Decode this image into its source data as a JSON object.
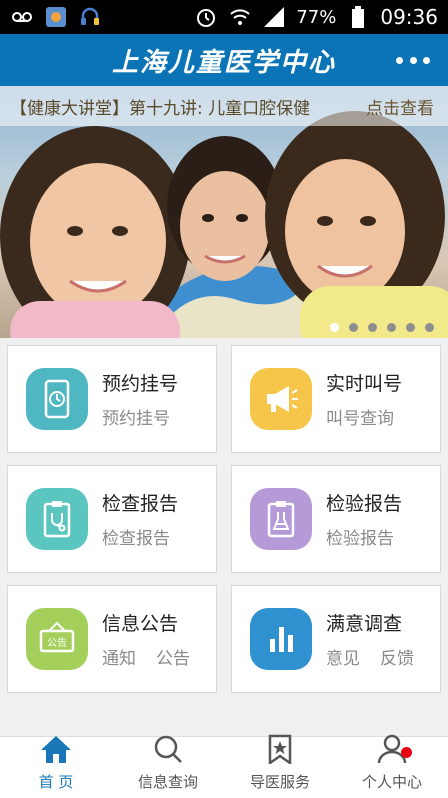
{
  "status_bar": {
    "battery": "77%",
    "time": "09:36",
    "icons": [
      "voicemail-icon",
      "app-notification-icon",
      "headset-icon",
      "alarm-icon",
      "wifi-icon",
      "signal-icon",
      "battery-icon"
    ]
  },
  "header": {
    "title": "上海儿童医学中心",
    "more_icon": "more-dots-icon"
  },
  "banner": {
    "notice": "【健康大讲堂】第十九讲: 儿童口腔保健",
    "link": "点击查看",
    "slide_count": 6,
    "active_slide": 1
  },
  "services": [
    {
      "title": "预约挂号",
      "sub": [
        "预约挂号"
      ],
      "icon": "phone-clock-icon",
      "color": "#4fb7c1"
    },
    {
      "title": "实时叫号",
      "sub": [
        "叫号查询"
      ],
      "icon": "megaphone-icon",
      "color": "#f6c64a"
    },
    {
      "title": "检查报告",
      "sub": [
        "检查报告"
      ],
      "icon": "stethoscope-clipboard-icon",
      "color": "#5bc5c0"
    },
    {
      "title": "检验报告",
      "sub": [
        "检验报告"
      ],
      "icon": "flask-clipboard-icon",
      "color": "#b59ad7"
    },
    {
      "title": "信息公告",
      "sub": [
        "通知",
        "公告"
      ],
      "icon": "notice-board-icon",
      "color": "#a3cf5a"
    },
    {
      "title": "满意调查",
      "sub": [
        "意见",
        "反馈"
      ],
      "icon": "bar-chart-icon",
      "color": "#2f91cf"
    }
  ],
  "tabs": [
    {
      "label": "首 页",
      "icon": "home-icon",
      "active": true
    },
    {
      "label": "信息查询",
      "icon": "search-icon",
      "active": false
    },
    {
      "label": "导医服务",
      "icon": "bookmark-star-icon",
      "active": false
    },
    {
      "label": "个人中心",
      "icon": "person-icon",
      "active": false,
      "badge": true
    }
  ],
  "colors": {
    "header_bg": "#0b74b6",
    "tab_active": "#1a78b8",
    "badge": "#e60012"
  }
}
